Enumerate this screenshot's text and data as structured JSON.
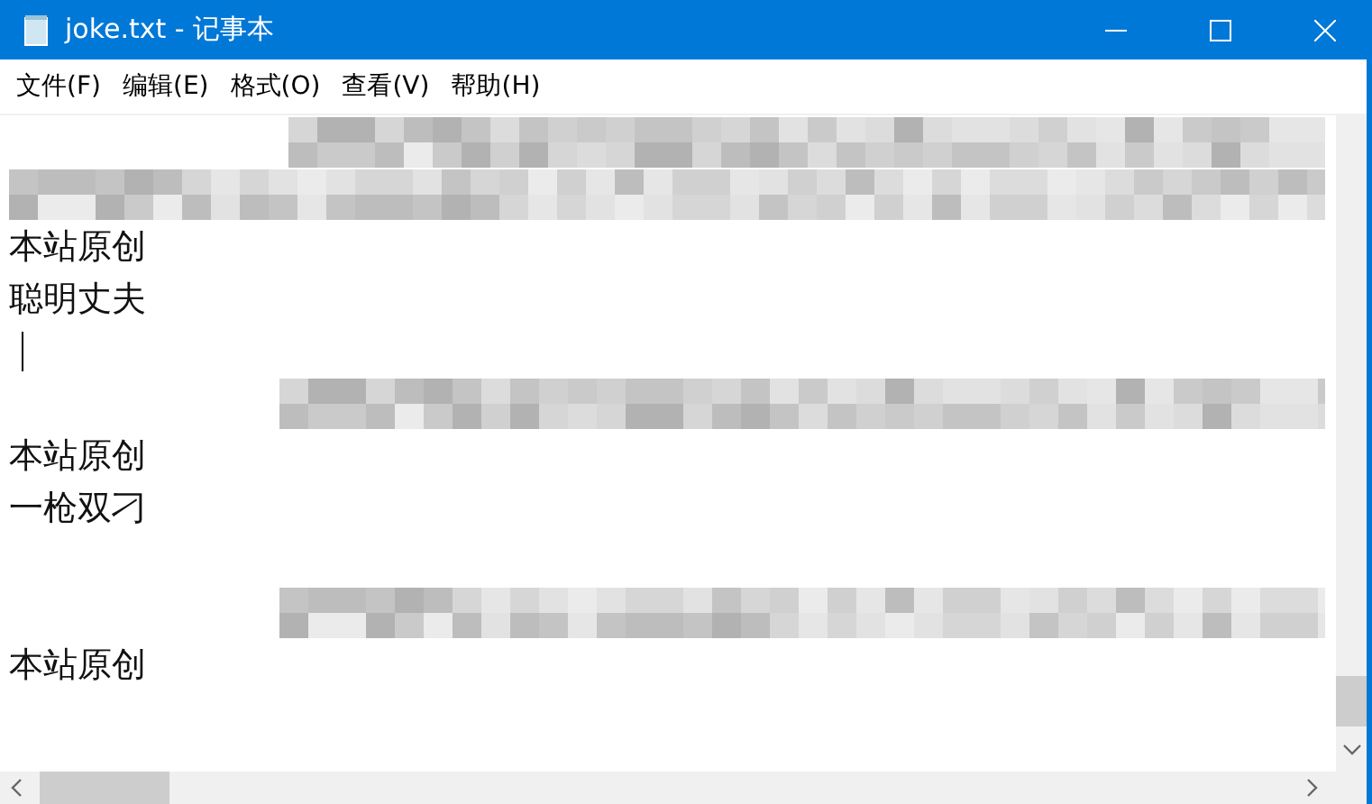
{
  "window": {
    "title": "joke.txt - 记事本"
  },
  "menu": [
    "文件(F)",
    "编辑(E)",
    "格式(O)",
    "查看(V)",
    "帮助(H)"
  ],
  "editor": {
    "lines": [
      {
        "kind": "blurred"
      },
      {
        "kind": "blurred"
      },
      {
        "kind": "text",
        "text": "本站原创"
      },
      {
        "kind": "text",
        "text": "聪明丈夫"
      },
      {
        "kind": "caret"
      },
      {
        "kind": "blurred"
      },
      {
        "kind": "text",
        "text": "本站原创"
      },
      {
        "kind": "text",
        "text": "一枪双刁"
      },
      {
        "kind": "empty"
      },
      {
        "kind": "blurred"
      },
      {
        "kind": "text",
        "text": "本站原创"
      }
    ]
  }
}
